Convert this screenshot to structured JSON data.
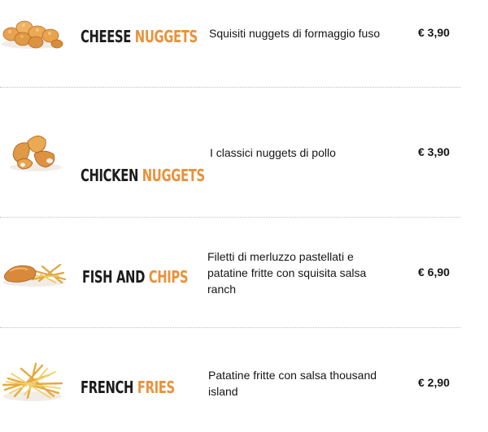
{
  "currency": "€",
  "items": [
    {
      "name_a": "Cheese",
      "name_b": "Nuggets",
      "description": "Squisiti nuggets di formaggio fuso",
      "price": "€ 3,90",
      "image_icon": "cheese-nuggets-photo"
    },
    {
      "name_a": "Chicken",
      "name_b": "Nuggets",
      "description": "I classici nuggets di pollo",
      "price": "€ 3,90",
      "image_icon": "chicken-nuggets-photo"
    },
    {
      "name_a": "Fish and",
      "name_b": "Chips",
      "description": "Filetti di merluzzo pastellati e patatine fritte con squisita salsa ranch",
      "price": "€ 6,90",
      "image_icon": "fish-and-chips-photo"
    },
    {
      "name_a": "French",
      "name_b": "Fries",
      "description": "Patatine fritte con salsa thousand island",
      "price": "€ 2,90",
      "image_icon": "french-fries-photo"
    }
  ],
  "colors": {
    "accent": "#e8923c",
    "text": "#1c1c1c",
    "divider": "#bfbfbf"
  }
}
